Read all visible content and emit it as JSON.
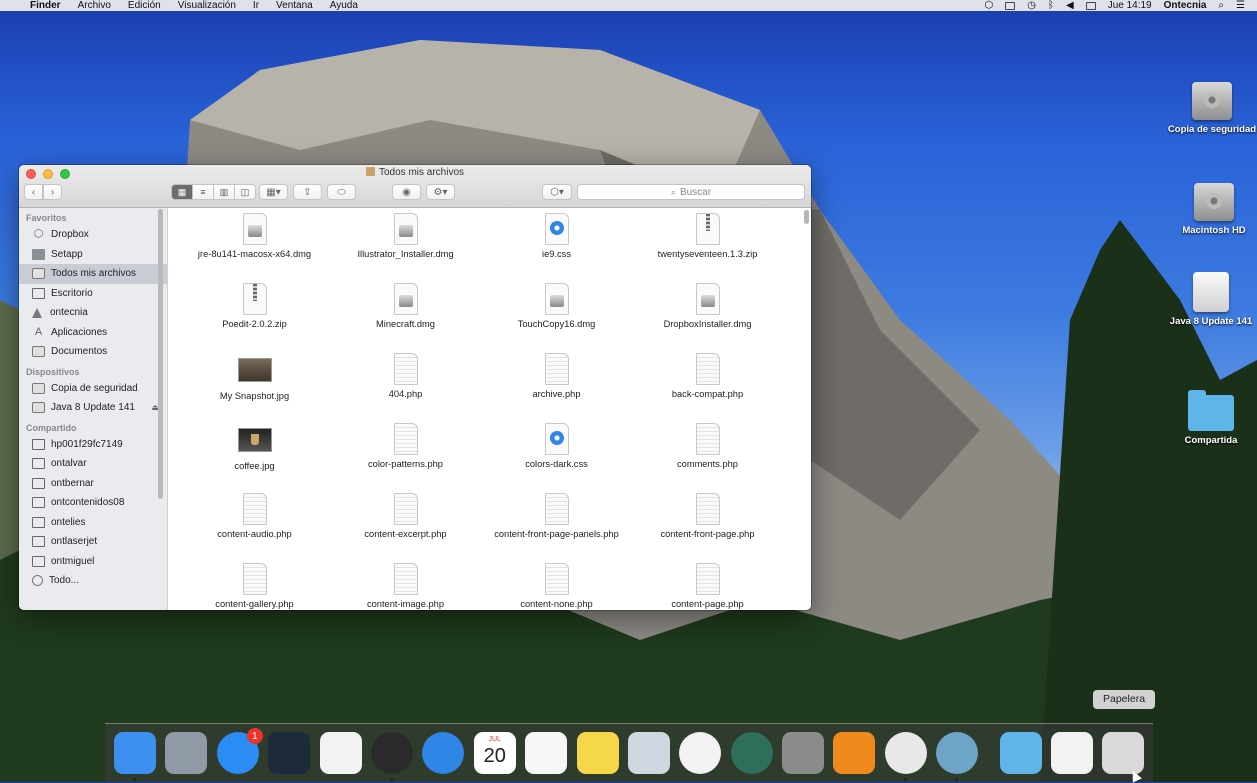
{
  "menubar": {
    "app_name": "Finder",
    "menus": [
      "Archivo",
      "Edición",
      "Visualización",
      "Ir",
      "Ventana",
      "Ayuda"
    ],
    "clock": "Jue 14:19",
    "user": "Ontecnia"
  },
  "desktop_items": [
    {
      "label": "Copia de seguridad",
      "icon": "hard-drive-icon"
    },
    {
      "label": "Macintosh HD",
      "icon": "hard-drive-icon"
    },
    {
      "label": "Java 8 Update 141",
      "icon": "external-drive-icon"
    },
    {
      "label": "Compartida",
      "icon": "folder-icon"
    }
  ],
  "finder": {
    "title": "Todos mis archivos",
    "search_placeholder": "Buscar",
    "sidebar": {
      "sections": [
        {
          "heading": "Favoritos",
          "items": [
            {
              "label": "Dropbox",
              "icon": "dropbox-icon"
            },
            {
              "label": "Setapp",
              "icon": "folder-icon"
            },
            {
              "label": "Todos mis archivos",
              "icon": "all-files-icon"
            },
            {
              "label": "Escritorio",
              "icon": "desktop-icon"
            },
            {
              "label": "ontecnia",
              "icon": "home-icon"
            },
            {
              "label": "Aplicaciones",
              "icon": "applications-icon"
            },
            {
              "label": "Documentos",
              "icon": "documents-icon"
            }
          ]
        },
        {
          "heading": "Dispositivos",
          "items": [
            {
              "label": "Copia de seguridad",
              "icon": "drive-icon"
            },
            {
              "label": "Java 8 Update 141",
              "icon": "drive-icon",
              "eject": "⏏"
            }
          ]
        },
        {
          "heading": "Compartido",
          "items": [
            {
              "label": "hp001f29fc7149",
              "icon": "computer-icon"
            },
            {
              "label": "ontalvar",
              "icon": "computer-icon"
            },
            {
              "label": "ontbernar",
              "icon": "computer-icon"
            },
            {
              "label": "ontcontenidos08",
              "icon": "computer-icon"
            },
            {
              "label": "ontelies",
              "icon": "computer-icon"
            },
            {
              "label": "ontlaserjet",
              "icon": "computer-icon"
            },
            {
              "label": "ontmiguel",
              "icon": "computer-icon"
            },
            {
              "label": "Todo...",
              "icon": "network-icon"
            }
          ]
        }
      ]
    },
    "files": [
      {
        "name": "jre-8u141-macosx-x64.dmg",
        "kind": "dmg"
      },
      {
        "name": "Illustrator_Installer.dmg",
        "kind": "dmg"
      },
      {
        "name": "ie9.css",
        "kind": "css"
      },
      {
        "name": "twentyseventeen.1.3.zip",
        "kind": "zip"
      },
      {
        "name": "Poedit-2.0.2.zip",
        "kind": "zip"
      },
      {
        "name": "Minecraft.dmg",
        "kind": "dmg"
      },
      {
        "name": "TouchCopy16.dmg",
        "kind": "dmg"
      },
      {
        "name": "DropboxInstaller.dmg",
        "kind": "dmg"
      },
      {
        "name": "My Snapshot.jpg",
        "kind": "jpg"
      },
      {
        "name": "404.php",
        "kind": "php"
      },
      {
        "name": "archive.php",
        "kind": "php"
      },
      {
        "name": "back-compat.php",
        "kind": "php"
      },
      {
        "name": "coffee.jpg",
        "kind": "jpg-coffee"
      },
      {
        "name": "color-patterns.php",
        "kind": "php"
      },
      {
        "name": "colors-dark.css",
        "kind": "css"
      },
      {
        "name": "comments.php",
        "kind": "php"
      },
      {
        "name": "content-audio.php",
        "kind": "php"
      },
      {
        "name": "content-excerpt.php",
        "kind": "php"
      },
      {
        "name": "content-front-page-panels.php",
        "kind": "php"
      },
      {
        "name": "content-front-page.php",
        "kind": "php"
      },
      {
        "name": "content-gallery.php",
        "kind": "php"
      },
      {
        "name": "content-image.php",
        "kind": "php"
      },
      {
        "name": "content-none.php",
        "kind": "php"
      },
      {
        "name": "content-page.php",
        "kind": "php"
      }
    ]
  },
  "dock": {
    "tooltip": "Papelera",
    "appstore_badge": "1",
    "calendar_month": "JUL",
    "calendar_day": "20",
    "apps": [
      {
        "icon": "finder-icon",
        "color": "#3d8ff0"
      },
      {
        "icon": "launchpad-icon",
        "color": "#8f9aa6"
      },
      {
        "icon": "app-store-icon",
        "color": "#2b8df3"
      },
      {
        "icon": "spider-app-icon",
        "color": "#1c2a3a"
      },
      {
        "icon": "textedit-icon",
        "color": "#f2f2f2"
      },
      {
        "icon": "dashboard-icon",
        "color": "#2a2a2a"
      },
      {
        "icon": "safari-icon",
        "color": "#2f86e6"
      },
      {
        "icon": "calendar-icon",
        "color": "#ffffff"
      },
      {
        "icon": "reminders-icon",
        "color": "#f7f7f7"
      },
      {
        "icon": "notes-icon",
        "color": "#f6d74a"
      },
      {
        "icon": "preview-icon",
        "color": "#cfd7e0"
      },
      {
        "icon": "photos-icon",
        "color": "#f2f2f2"
      },
      {
        "icon": "time-machine-icon",
        "color": "#2e6f5c"
      },
      {
        "icon": "system-preferences-icon",
        "color": "#8b8b8b"
      },
      {
        "icon": "ibooks-icon",
        "color": "#f08a1c"
      },
      {
        "icon": "chrome-icon",
        "color": "#e8e8e8"
      },
      {
        "icon": "webcam-app-icon",
        "color": "#6ea4c8"
      }
    ],
    "stack": [
      {
        "icon": "downloads-folder-icon",
        "color": "#5fb4ea"
      },
      {
        "icon": "document-stack-icon",
        "color": "#f2f2f2"
      },
      {
        "icon": "trash-icon",
        "color": "#d9d9d9"
      }
    ]
  }
}
